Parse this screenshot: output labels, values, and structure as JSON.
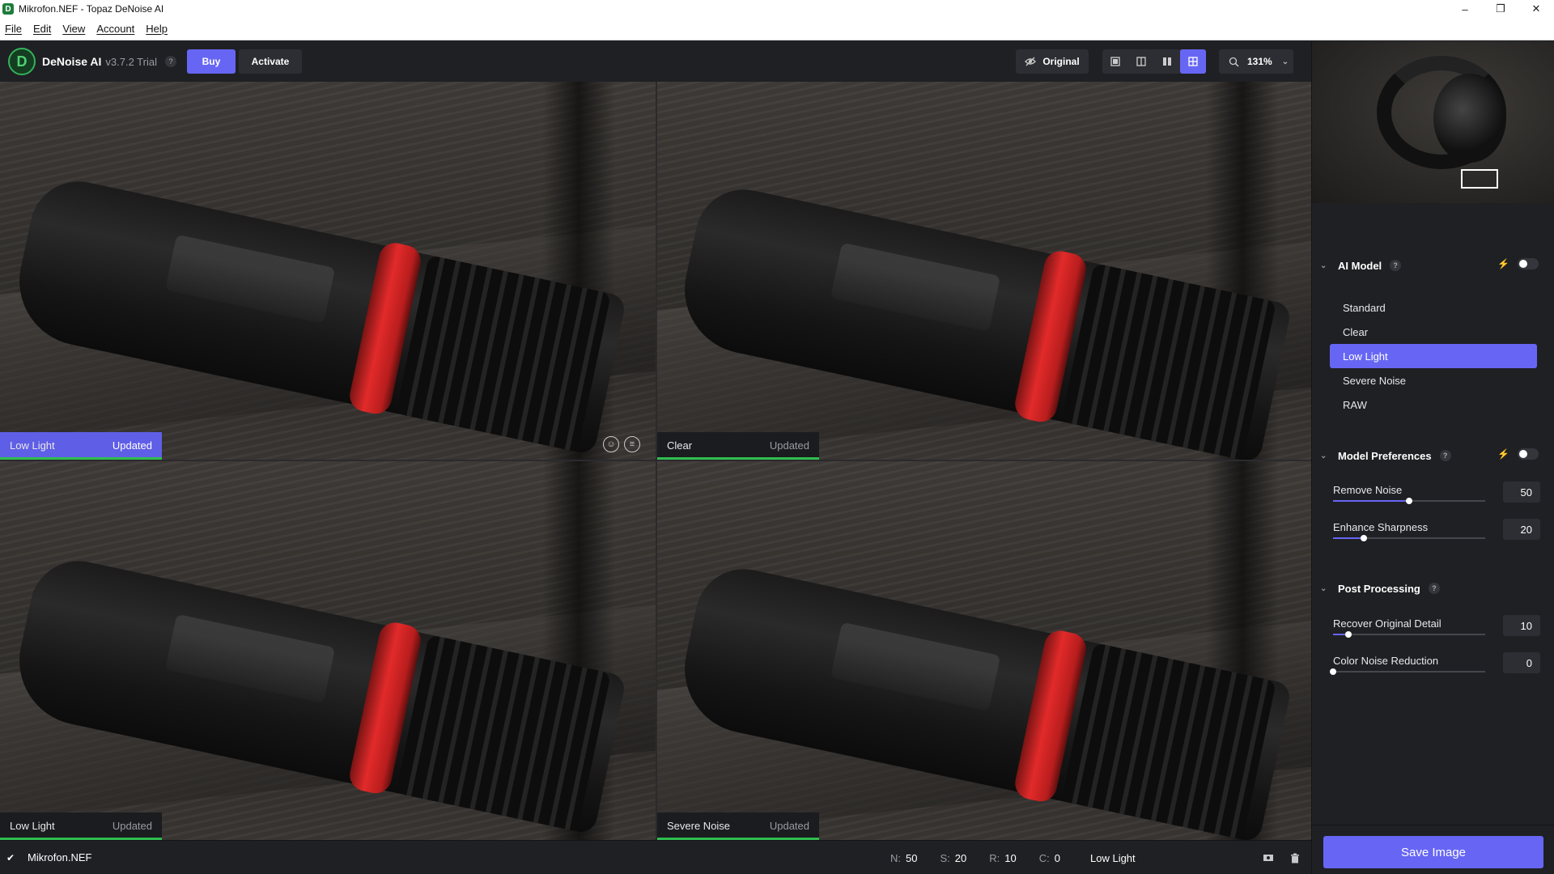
{
  "window": {
    "title": "Mikrofon.NEF - Topaz DeNoise AI",
    "app_icon": "D"
  },
  "menu": [
    "File",
    "Edit",
    "View",
    "Account",
    "Help"
  ],
  "toolbar": {
    "logo_letter": "D",
    "app_name": "DeNoise AI",
    "version": "v3.7.2 Trial",
    "help": "?",
    "buy_label": "Buy",
    "activate_label": "Activate",
    "original_label": "Original",
    "zoom_label": "131%"
  },
  "panes": [
    {
      "model": "Low Light",
      "status": "Updated",
      "active": true
    },
    {
      "model": "Clear",
      "status": "Updated",
      "active": false
    },
    {
      "model": "Low Light",
      "status": "Updated",
      "active": false
    },
    {
      "model": "Severe Noise",
      "status": "Updated",
      "active": false
    }
  ],
  "sidebar": {
    "ai_model": {
      "title": "AI Model",
      "help": "?",
      "items": [
        "Standard",
        "Clear",
        "Low Light",
        "Severe Noise",
        "RAW"
      ],
      "selected": "Low Light"
    },
    "model_preferences": {
      "title": "Model Preferences",
      "help": "?",
      "sliders": [
        {
          "label": "Remove Noise",
          "value": "50",
          "fraction": 0.5
        },
        {
          "label": "Enhance Sharpness",
          "value": "20",
          "fraction": 0.2
        }
      ]
    },
    "post_processing": {
      "title": "Post Processing",
      "help": "?",
      "sliders": [
        {
          "label": "Recover Original Detail",
          "value": "10",
          "fraction": 0.1
        },
        {
          "label": "Color Noise Reduction",
          "value": "0",
          "fraction": 0.0
        }
      ]
    },
    "save_label": "Save Image"
  },
  "statusbar": {
    "filename": "Mikrofon.NEF",
    "stats": [
      {
        "key": "N:",
        "value": "50"
      },
      {
        "key": "S:",
        "value": "20"
      },
      {
        "key": "R:",
        "value": "10"
      },
      {
        "key": "C:",
        "value": "0"
      }
    ],
    "model": "Low Light"
  },
  "colors": {
    "accent": "#6766f4",
    "progress": "#2fbe4e",
    "background": "#1f2024"
  }
}
